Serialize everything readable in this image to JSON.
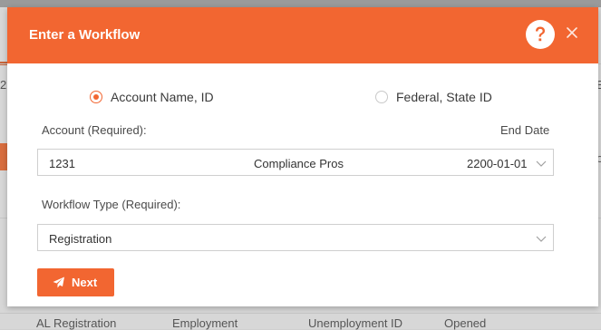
{
  "background": {
    "edge_left": "2",
    "edge_right": "B",
    "edge_right_lower": "o",
    "bottom_row": [
      "AL Registration",
      "Employment",
      "Unemployment ID",
      "Opened"
    ]
  },
  "modal": {
    "title": "Enter a Workflow",
    "help_icon": "question-circle-icon",
    "close_icon": "close-icon"
  },
  "search_mode": {
    "options": [
      {
        "label": "Account Name, ID",
        "checked": true
      },
      {
        "label": "Federal, State ID",
        "checked": false
      }
    ]
  },
  "account": {
    "label": "Account (Required):",
    "end_date_label": "End Date",
    "id": "1231",
    "name": "Compliance Pros",
    "end_date": "2200-01-01"
  },
  "workflow_type": {
    "label": "Workflow Type (Required):",
    "value": "Registration"
  },
  "actions": {
    "next_label": "Next"
  },
  "colors": {
    "accent": "#f26631",
    "header_text": "#ffffff"
  }
}
